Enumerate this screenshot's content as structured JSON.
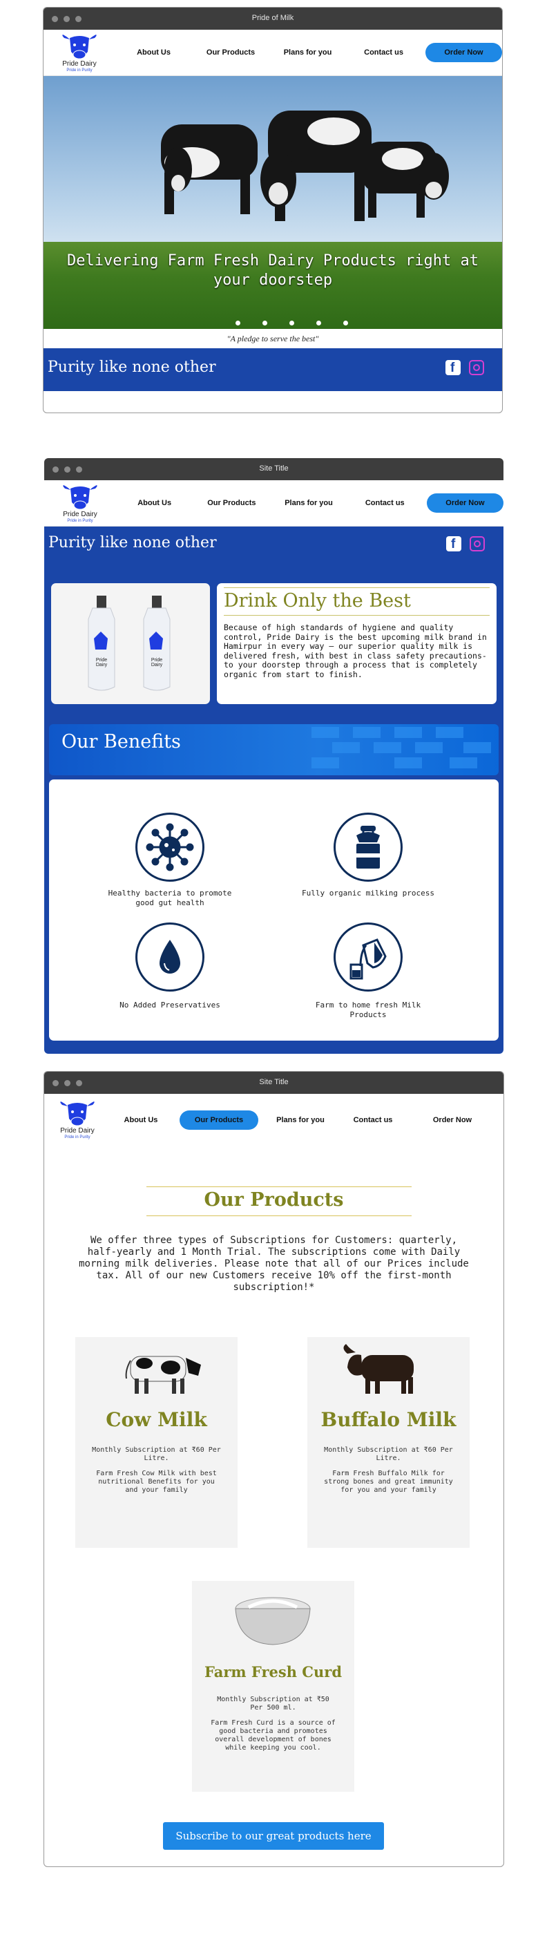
{
  "brand": {
    "name": "Pride Dairy",
    "tagline": "Pride in Purity"
  },
  "window1": {
    "title": "Pride of Milk",
    "nav": [
      "About Us",
      "Our Products",
      "Plans for you",
      "Contact us",
      "Order Now"
    ],
    "hero_heading": "Delivering Farm Fresh Dairy Products right at your doorstep",
    "carousel_count": 5,
    "pledge": "\"A pledge to serve the best\"",
    "banner": "Purity like none other"
  },
  "window2": {
    "title": "Site Title",
    "nav": [
      "About Us",
      "Our Products",
      "Plans for you",
      "Contact us",
      "Order Now"
    ],
    "banner": "Purity like none other",
    "drink": {
      "title": "Drink Only the Best",
      "body": "Because of high standards of hygiene and quality control, Pride Dairy is the best upcoming milk brand in Hamirpur in every way – our superior quality milk is delivered fresh, with best in class safety precautions- to your doorstep through a process that is completely organic from start to finish."
    },
    "bottle_label": "Pride Dairy",
    "benefits_title": "Our Benefits",
    "benefits": [
      {
        "label": "Healthy bacteria to promote good gut health",
        "icon": "bacteria-icon"
      },
      {
        "label": "Fully organic milking process",
        "icon": "milk-can-icon"
      },
      {
        "label": "No Added Preservatives",
        "icon": "water-drop-icon"
      },
      {
        "label": "Farm to home fresh Milk Products",
        "icon": "milk-pour-icon"
      }
    ]
  },
  "window3": {
    "title": "Site Title",
    "nav": [
      "About Us",
      "Our Products",
      "Plans for you",
      "Contact us",
      "Order Now"
    ],
    "heading": "Our Products",
    "intro": "We offer three types of Subscriptions for Customers: quarterly, half-yearly and 1 Month Trial. The subscriptions come with Daily morning milk deliveries. Please note that all of our Prices include tax. All of our new Customers receive 10% off the first-month subscription!*",
    "products": [
      {
        "name": "Cow Milk",
        "price": "Monthly Subscription at ₹60 Per Litre.",
        "desc": "Farm Fresh Cow Milk with best nutritional Benefits for you and your family"
      },
      {
        "name": "Buffalo Milk",
        "price": "Monthly Subscription at ₹60 Per Litre.",
        "desc": "Farm Fresh Buffalo Milk for strong bones and great immunity for you and your family"
      },
      {
        "name": "Farm Fresh Curd",
        "price": "Monthly Subscription at ₹50 Per 500 ml.",
        "desc": "Farm Fresh Curd is a source of good bacteria and promotes overall development of bones while keeping you cool."
      }
    ],
    "cta": "Subscribe to our great products here"
  },
  "colors": {
    "accent": "#1e88e5",
    "brand_blue": "#1a46a8",
    "olive": "#7f8421",
    "instagram": "#d53fd0"
  }
}
